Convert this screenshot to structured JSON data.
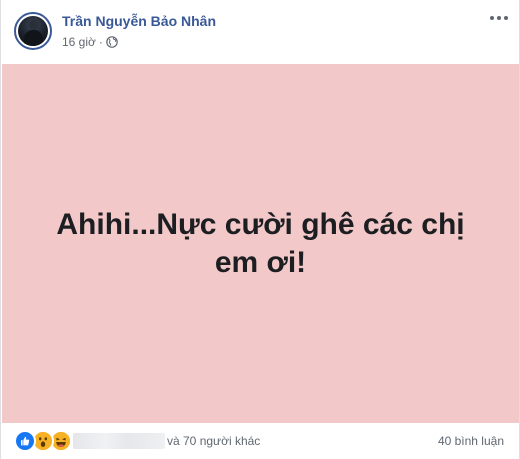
{
  "post": {
    "author_name": "Trần Nguyễn Bảo Nhân",
    "timestamp": "16 giờ",
    "separator": "·",
    "privacy_icon": "globe-icon",
    "more_icon": "more-dots-icon",
    "status_text": "Ahihi...Nực cười ghê các chị em ơi!",
    "status_background": "#f2c8c8"
  },
  "footer": {
    "reaction_icons": [
      "like-icon",
      "wow-icon",
      "haha-icon"
    ],
    "others_text": "và 70 người khác",
    "comments_text": "40 bình luận"
  },
  "colors": {
    "author": "#385898",
    "like": "#1877f2",
    "emoji": "#f7b125"
  }
}
